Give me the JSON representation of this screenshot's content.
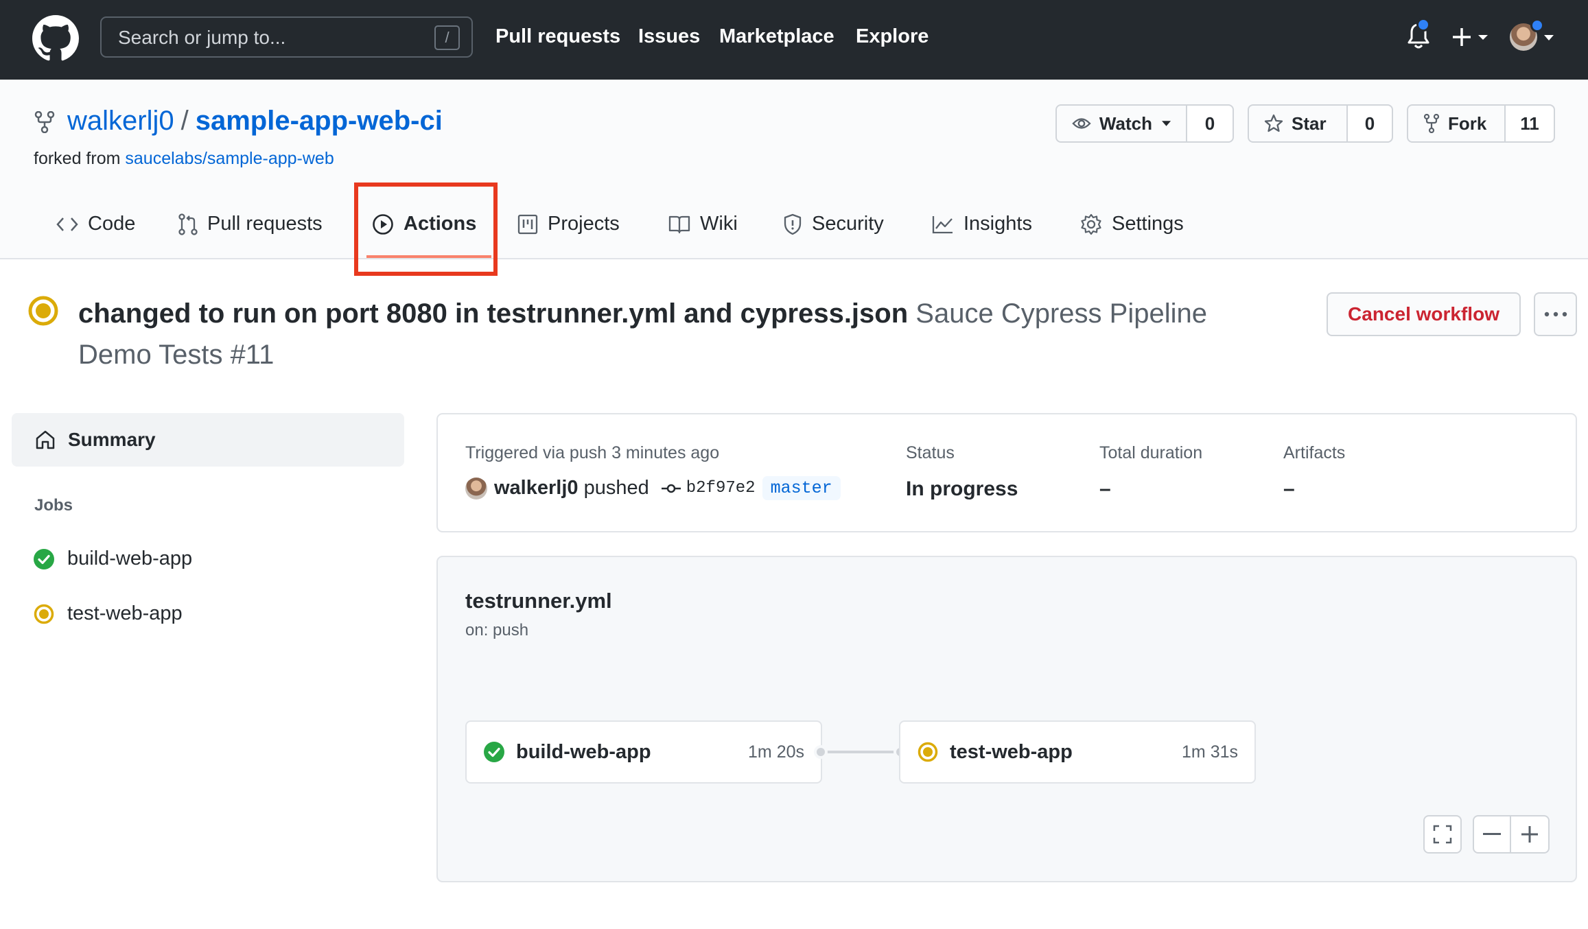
{
  "header": {
    "search_placeholder": "Search or jump to...",
    "search_shortcut": "/",
    "nav": [
      "Pull requests",
      "Issues",
      "Marketplace",
      "Explore"
    ]
  },
  "repo": {
    "owner": "walkerlj0",
    "separator": "/",
    "name": "sample-app-web-ci",
    "forked_prefix": "forked from",
    "forked_source": "saucelabs/sample-app-web",
    "watch": {
      "label": "Watch",
      "count": "0"
    },
    "star": {
      "label": "Star",
      "count": "0"
    },
    "fork": {
      "label": "Fork",
      "count": "11"
    }
  },
  "tabs": [
    {
      "label": "Code",
      "icon": "code-icon"
    },
    {
      "label": "Pull requests",
      "icon": "pull-request-icon"
    },
    {
      "label": "Actions",
      "icon": "play-icon",
      "active": true
    },
    {
      "label": "Projects",
      "icon": "project-icon"
    },
    {
      "label": "Wiki",
      "icon": "book-icon"
    },
    {
      "label": "Security",
      "icon": "shield-icon"
    },
    {
      "label": "Insights",
      "icon": "graph-icon"
    },
    {
      "label": "Settings",
      "icon": "gear-icon"
    }
  ],
  "workflow": {
    "commit_message": "changed to run on port 8080 in testrunner.yml and cypress.json",
    "name": "Sauce Cypress Pipeline Demo Tests #11",
    "cancel_label": "Cancel workflow",
    "more_label": "···"
  },
  "sidebar": {
    "summary_label": "Summary",
    "jobs_label": "Jobs",
    "jobs": [
      {
        "name": "build-web-app",
        "status": "success"
      },
      {
        "name": "test-web-app",
        "status": "in-progress"
      }
    ]
  },
  "info": {
    "trigger_label": "Triggered via push 3 minutes ago",
    "user": "walkerlj0",
    "action": "pushed",
    "commit_sha": "b2f97e2",
    "branch": "master",
    "status_label": "Status",
    "status_value": "In progress",
    "duration_label": "Total duration",
    "duration_value": "–",
    "artifacts_label": "Artifacts",
    "artifacts_value": "–"
  },
  "graph": {
    "file": "testrunner.yml",
    "trigger": "on: push",
    "jobs": [
      {
        "name": "build-web-app",
        "time": "1m 20s",
        "status": "success"
      },
      {
        "name": "test-web-app",
        "time": "1m 31s",
        "status": "in-progress"
      }
    ]
  },
  "colors": {
    "header_bg": "#24292e",
    "link": "#0366d6",
    "success": "#28a745",
    "in_progress": "#dbab09",
    "danger": "#cb2431",
    "highlight_box": "#e8391e",
    "tab_underline": "#f9826c"
  }
}
